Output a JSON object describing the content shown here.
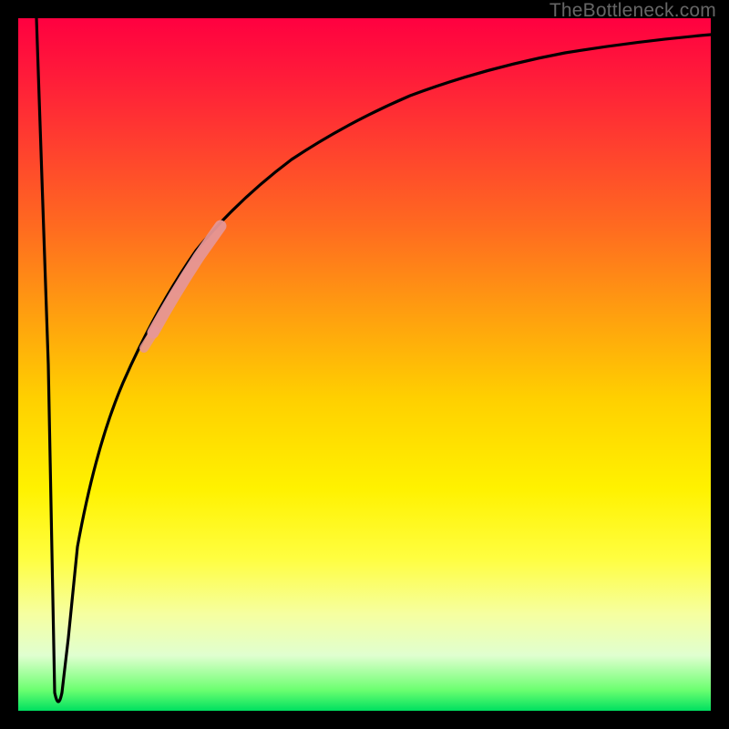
{
  "watermark": "TheBottleneck.com",
  "chart_data": {
    "type": "line",
    "title": "",
    "xlabel": "",
    "ylabel": "",
    "xlim": [
      0,
      100
    ],
    "ylim": [
      0,
      100
    ],
    "grid": false,
    "series": [
      {
        "name": "bottleneck-curve",
        "color": "#000000",
        "x": [
          0,
          2,
          4,
          5,
          6,
          7,
          8,
          10,
          12,
          15,
          18,
          22,
          26,
          30,
          35,
          40,
          50,
          60,
          70,
          80,
          90,
          100
        ],
        "values": [
          100,
          50,
          4,
          2,
          4,
          12,
          22,
          38,
          50,
          60,
          67,
          73,
          78,
          82,
          85,
          88,
          91,
          93,
          95,
          96,
          97,
          98
        ]
      }
    ],
    "highlight": {
      "name": "highlighted-segment",
      "color": "#e69696",
      "x_range": [
        18,
        26
      ],
      "y_range": [
        57,
        78
      ]
    },
    "background_gradient": {
      "orientation": "vertical",
      "stops": [
        {
          "pos": 0,
          "color": "#ff0040"
        },
        {
          "pos": 55,
          "color": "#ffd000"
        },
        {
          "pos": 78,
          "color": "#fffe40"
        },
        {
          "pos": 100,
          "color": "#00e060"
        }
      ]
    }
  }
}
